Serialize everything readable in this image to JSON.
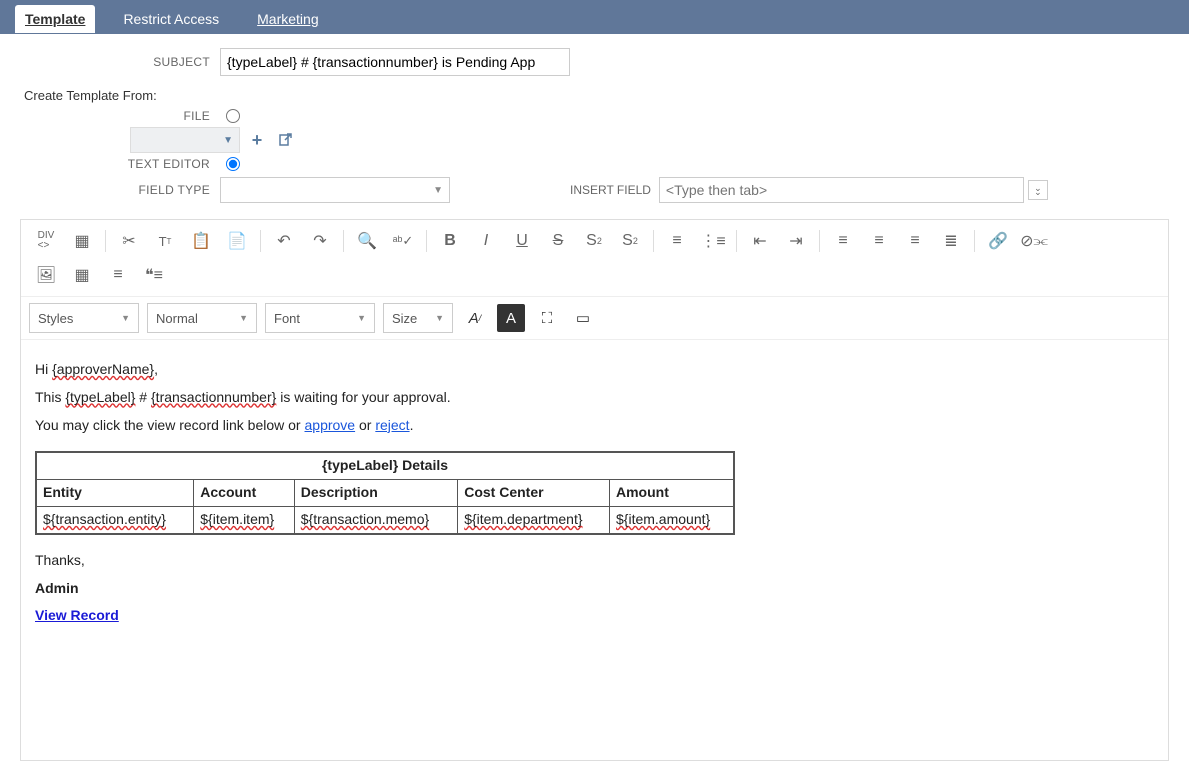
{
  "tabs": {
    "template": "Template",
    "restrict": "Restrict Access",
    "marketing": "Marketing"
  },
  "labels": {
    "subject": "SUBJECT",
    "create_from": "Create Template From:",
    "file": "FILE",
    "text_editor": "TEXT EDITOR",
    "field_type": "FIELD TYPE",
    "insert_field": "INSERT FIELD"
  },
  "values": {
    "subject": "{typeLabel} # {transactionnumber} is Pending App",
    "insert_field_placeholder": "<Type then tab>"
  },
  "combos": {
    "styles": "Styles",
    "format": "Normal",
    "font": "Font",
    "size": "Size"
  },
  "body": {
    "greeting_pre": "Hi ",
    "greeting_var": "{approverName}",
    "greeting_post": ",",
    "line2_a": "This ",
    "line2_var1": "{typeLabel}",
    "line2_b": " # ",
    "line2_var2": "{transactionnumber}",
    "line2_c": " is waiting for your approval.",
    "line3_a": "You may click the view record link below or ",
    "line3_approve": "approve",
    "line3_b": " or ",
    "line3_reject": "reject",
    "line3_c": ".",
    "table_title": "{typeLabel} Details",
    "headers": {
      "c1": "Entity",
      "c2": "Account",
      "c3": "Description",
      "c4": "Cost Center",
      "c5": "Amount"
    },
    "cells": {
      "c1": "${transaction.entity}",
      "c2": "${item.item}",
      "c3": "${transaction.memo}",
      "c4": "${item.department}",
      "c5": "${item.amount}"
    },
    "thanks": "Thanks,",
    "signature": "Admin",
    "view_record": "View Record"
  }
}
